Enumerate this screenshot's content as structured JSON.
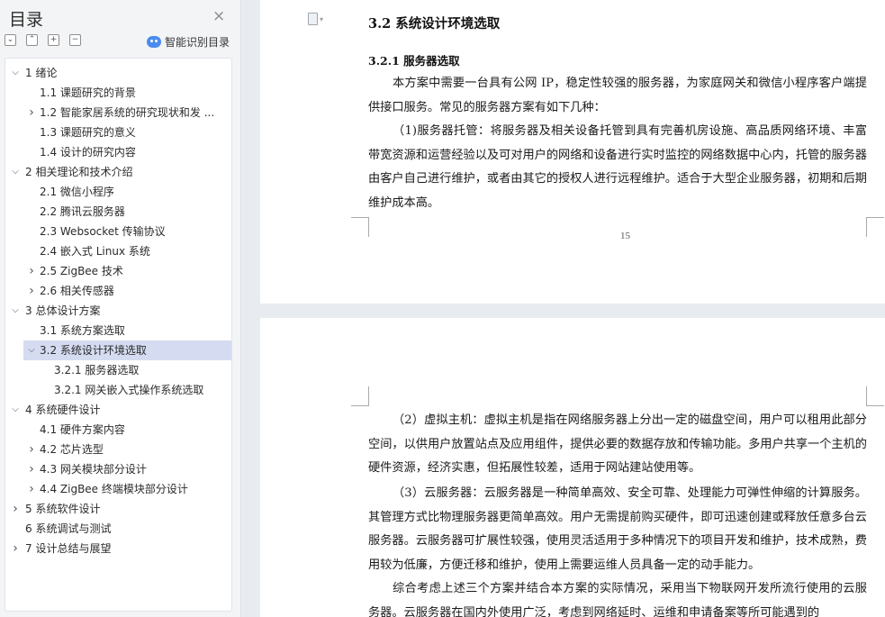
{
  "sidebar": {
    "title": "目录",
    "close_icon": "×",
    "tools": [
      "⌄",
      "⌃",
      "+",
      "−"
    ],
    "smart_label": "智能识别目录",
    "toc": [
      {
        "level": 1,
        "label": "1  绪论",
        "chev": "down"
      },
      {
        "level": 2,
        "label": "1.1  课题研究的背景",
        "chev": "none"
      },
      {
        "level": 2,
        "label": "1.2  智能家居系统的研究现状和发 ...",
        "chev": "right"
      },
      {
        "level": 2,
        "label": "1.3  课题研究的意义",
        "chev": "none"
      },
      {
        "level": 2,
        "label": "1.4  设计的研究内容",
        "chev": "none"
      },
      {
        "level": 1,
        "label": "2  相关理论和技术介绍",
        "chev": "down"
      },
      {
        "level": 2,
        "label": "2.1  微信小程序",
        "chev": "none"
      },
      {
        "level": 2,
        "label": "2.2  腾讯云服务器",
        "chev": "none"
      },
      {
        "level": 2,
        "label": "2.3 Websocket 传输协议",
        "chev": "none"
      },
      {
        "level": 2,
        "label": "2.4  嵌入式 Linux 系统",
        "chev": "none"
      },
      {
        "level": 2,
        "label": "2.5 ZigBee 技术",
        "chev": "right"
      },
      {
        "level": 2,
        "label": "2.6  相关传感器",
        "chev": "right"
      },
      {
        "level": 1,
        "label": "3  总体设计方案",
        "chev": "down"
      },
      {
        "level": 2,
        "label": "3.1  系统方案选取",
        "chev": "none"
      },
      {
        "level": 2,
        "label": "3.2  系统设计环境选取",
        "chev": "down",
        "active": true
      },
      {
        "level": 3,
        "label": "3.2.1  服务器选取",
        "chev": "none"
      },
      {
        "level": 3,
        "label": "3.2.1  网关嵌入式操作系统选取",
        "chev": "none"
      },
      {
        "level": 1,
        "label": "4  系统硬件设计",
        "chev": "down"
      },
      {
        "level": 2,
        "label": "4.1  硬件方案内容",
        "chev": "none"
      },
      {
        "level": 2,
        "label": "4.2  芯片选型",
        "chev": "right"
      },
      {
        "level": 2,
        "label": "4.3  网关模块部分设计",
        "chev": "right"
      },
      {
        "level": 2,
        "label": "4.4 ZigBee 终端模块部分设计",
        "chev": "right"
      },
      {
        "level": 1,
        "label": "5  系统软件设计",
        "chev": "right"
      },
      {
        "level": 1,
        "label": "6  系统调试与测试",
        "chev": "none"
      },
      {
        "level": 1,
        "label": "7  设计总结与展望",
        "chev": "right"
      }
    ]
  },
  "document": {
    "page_icon_dropdown": "▾",
    "heading2": "3.2  系统设计环境选取",
    "heading3": "3.2.1  服务器选取",
    "p1": "本方案中需要一台具有公网 IP，稳定性较强的服务器，为家庭网关和微信小程序客户端提供接口服务。常见的服务器方案有如下几种：",
    "p2": "（1)服务器托管：将服务器及相关设备托管到具有完善机房设施、高品质网络环境、丰富带宽资源和运营经验以及可对用户的网络和设备进行实时监控的网络数据中心内，托管的服务器由客户自己进行维护，或者由其它的授权人进行远程维护。适合于大型企业服务器，初期和后期维护成本高。",
    "page_number": "15",
    "p3": "（2）虚拟主机：虚拟主机是指在网络服务器上分出一定的磁盘空间，用户可以租用此部分空间，以供用户放置站点及应用组件，提供必要的数据存放和传输功能。多用户共享一个主机的硬件资源，经济实惠，但拓展性较差，适用于网站建站使用等。",
    "p4": "（3）云服务器：云服务器是一种简单高效、安全可靠、处理能力可弹性伸缩的计算服务。其管理方式比物理服务器更简单高效。用户无需提前购买硬件，即可迅速创建或释放任意多台云服务器。云服务器可扩展性较强，使用灵活适用于多种情况下的项目开发和维护，技术成熟，费用较为低廉，方便迁移和维护，使用上需要运维人员具备一定的动手能力。",
    "p5": "综合考虑上述三个方案并结合本方案的实际情况，采用当下物联网开发所流行使用的云服务器。云服务器在国内外使用广泛，考虑到网络延时、运维和申请备案等所可能遇到的"
  }
}
